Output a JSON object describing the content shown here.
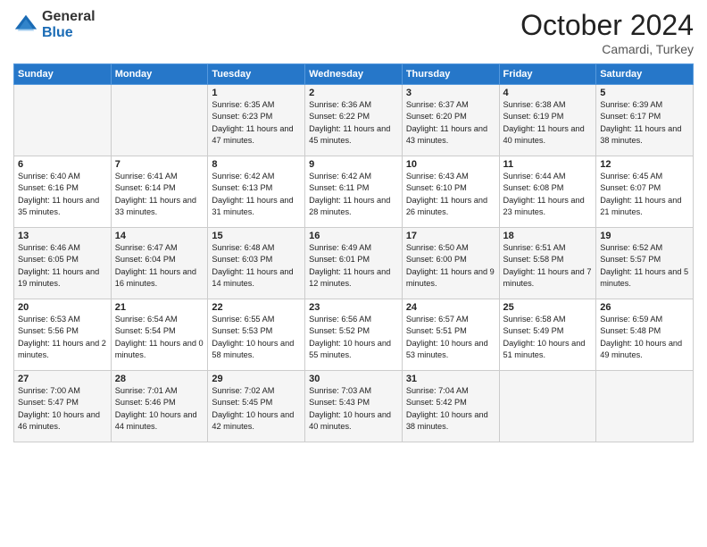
{
  "logo": {
    "general": "General",
    "blue": "Blue"
  },
  "header": {
    "month": "October 2024",
    "location": "Camardi, Turkey"
  },
  "days_of_week": [
    "Sunday",
    "Monday",
    "Tuesday",
    "Wednesday",
    "Thursday",
    "Friday",
    "Saturday"
  ],
  "weeks": [
    [
      {
        "day": "",
        "info": ""
      },
      {
        "day": "",
        "info": ""
      },
      {
        "day": "1",
        "info": "Sunrise: 6:35 AM\nSunset: 6:23 PM\nDaylight: 11 hours and 47 minutes."
      },
      {
        "day": "2",
        "info": "Sunrise: 6:36 AM\nSunset: 6:22 PM\nDaylight: 11 hours and 45 minutes."
      },
      {
        "day": "3",
        "info": "Sunrise: 6:37 AM\nSunset: 6:20 PM\nDaylight: 11 hours and 43 minutes."
      },
      {
        "day": "4",
        "info": "Sunrise: 6:38 AM\nSunset: 6:19 PM\nDaylight: 11 hours and 40 minutes."
      },
      {
        "day": "5",
        "info": "Sunrise: 6:39 AM\nSunset: 6:17 PM\nDaylight: 11 hours and 38 minutes."
      }
    ],
    [
      {
        "day": "6",
        "info": "Sunrise: 6:40 AM\nSunset: 6:16 PM\nDaylight: 11 hours and 35 minutes."
      },
      {
        "day": "7",
        "info": "Sunrise: 6:41 AM\nSunset: 6:14 PM\nDaylight: 11 hours and 33 minutes."
      },
      {
        "day": "8",
        "info": "Sunrise: 6:42 AM\nSunset: 6:13 PM\nDaylight: 11 hours and 31 minutes."
      },
      {
        "day": "9",
        "info": "Sunrise: 6:42 AM\nSunset: 6:11 PM\nDaylight: 11 hours and 28 minutes."
      },
      {
        "day": "10",
        "info": "Sunrise: 6:43 AM\nSunset: 6:10 PM\nDaylight: 11 hours and 26 minutes."
      },
      {
        "day": "11",
        "info": "Sunrise: 6:44 AM\nSunset: 6:08 PM\nDaylight: 11 hours and 23 minutes."
      },
      {
        "day": "12",
        "info": "Sunrise: 6:45 AM\nSunset: 6:07 PM\nDaylight: 11 hours and 21 minutes."
      }
    ],
    [
      {
        "day": "13",
        "info": "Sunrise: 6:46 AM\nSunset: 6:05 PM\nDaylight: 11 hours and 19 minutes."
      },
      {
        "day": "14",
        "info": "Sunrise: 6:47 AM\nSunset: 6:04 PM\nDaylight: 11 hours and 16 minutes."
      },
      {
        "day": "15",
        "info": "Sunrise: 6:48 AM\nSunset: 6:03 PM\nDaylight: 11 hours and 14 minutes."
      },
      {
        "day": "16",
        "info": "Sunrise: 6:49 AM\nSunset: 6:01 PM\nDaylight: 11 hours and 12 minutes."
      },
      {
        "day": "17",
        "info": "Sunrise: 6:50 AM\nSunset: 6:00 PM\nDaylight: 11 hours and 9 minutes."
      },
      {
        "day": "18",
        "info": "Sunrise: 6:51 AM\nSunset: 5:58 PM\nDaylight: 11 hours and 7 minutes."
      },
      {
        "day": "19",
        "info": "Sunrise: 6:52 AM\nSunset: 5:57 PM\nDaylight: 11 hours and 5 minutes."
      }
    ],
    [
      {
        "day": "20",
        "info": "Sunrise: 6:53 AM\nSunset: 5:56 PM\nDaylight: 11 hours and 2 minutes."
      },
      {
        "day": "21",
        "info": "Sunrise: 6:54 AM\nSunset: 5:54 PM\nDaylight: 11 hours and 0 minutes."
      },
      {
        "day": "22",
        "info": "Sunrise: 6:55 AM\nSunset: 5:53 PM\nDaylight: 10 hours and 58 minutes."
      },
      {
        "day": "23",
        "info": "Sunrise: 6:56 AM\nSunset: 5:52 PM\nDaylight: 10 hours and 55 minutes."
      },
      {
        "day": "24",
        "info": "Sunrise: 6:57 AM\nSunset: 5:51 PM\nDaylight: 10 hours and 53 minutes."
      },
      {
        "day": "25",
        "info": "Sunrise: 6:58 AM\nSunset: 5:49 PM\nDaylight: 10 hours and 51 minutes."
      },
      {
        "day": "26",
        "info": "Sunrise: 6:59 AM\nSunset: 5:48 PM\nDaylight: 10 hours and 49 minutes."
      }
    ],
    [
      {
        "day": "27",
        "info": "Sunrise: 7:00 AM\nSunset: 5:47 PM\nDaylight: 10 hours and 46 minutes."
      },
      {
        "day": "28",
        "info": "Sunrise: 7:01 AM\nSunset: 5:46 PM\nDaylight: 10 hours and 44 minutes."
      },
      {
        "day": "29",
        "info": "Sunrise: 7:02 AM\nSunset: 5:45 PM\nDaylight: 10 hours and 42 minutes."
      },
      {
        "day": "30",
        "info": "Sunrise: 7:03 AM\nSunset: 5:43 PM\nDaylight: 10 hours and 40 minutes."
      },
      {
        "day": "31",
        "info": "Sunrise: 7:04 AM\nSunset: 5:42 PM\nDaylight: 10 hours and 38 minutes."
      },
      {
        "day": "",
        "info": ""
      },
      {
        "day": "",
        "info": ""
      }
    ]
  ]
}
